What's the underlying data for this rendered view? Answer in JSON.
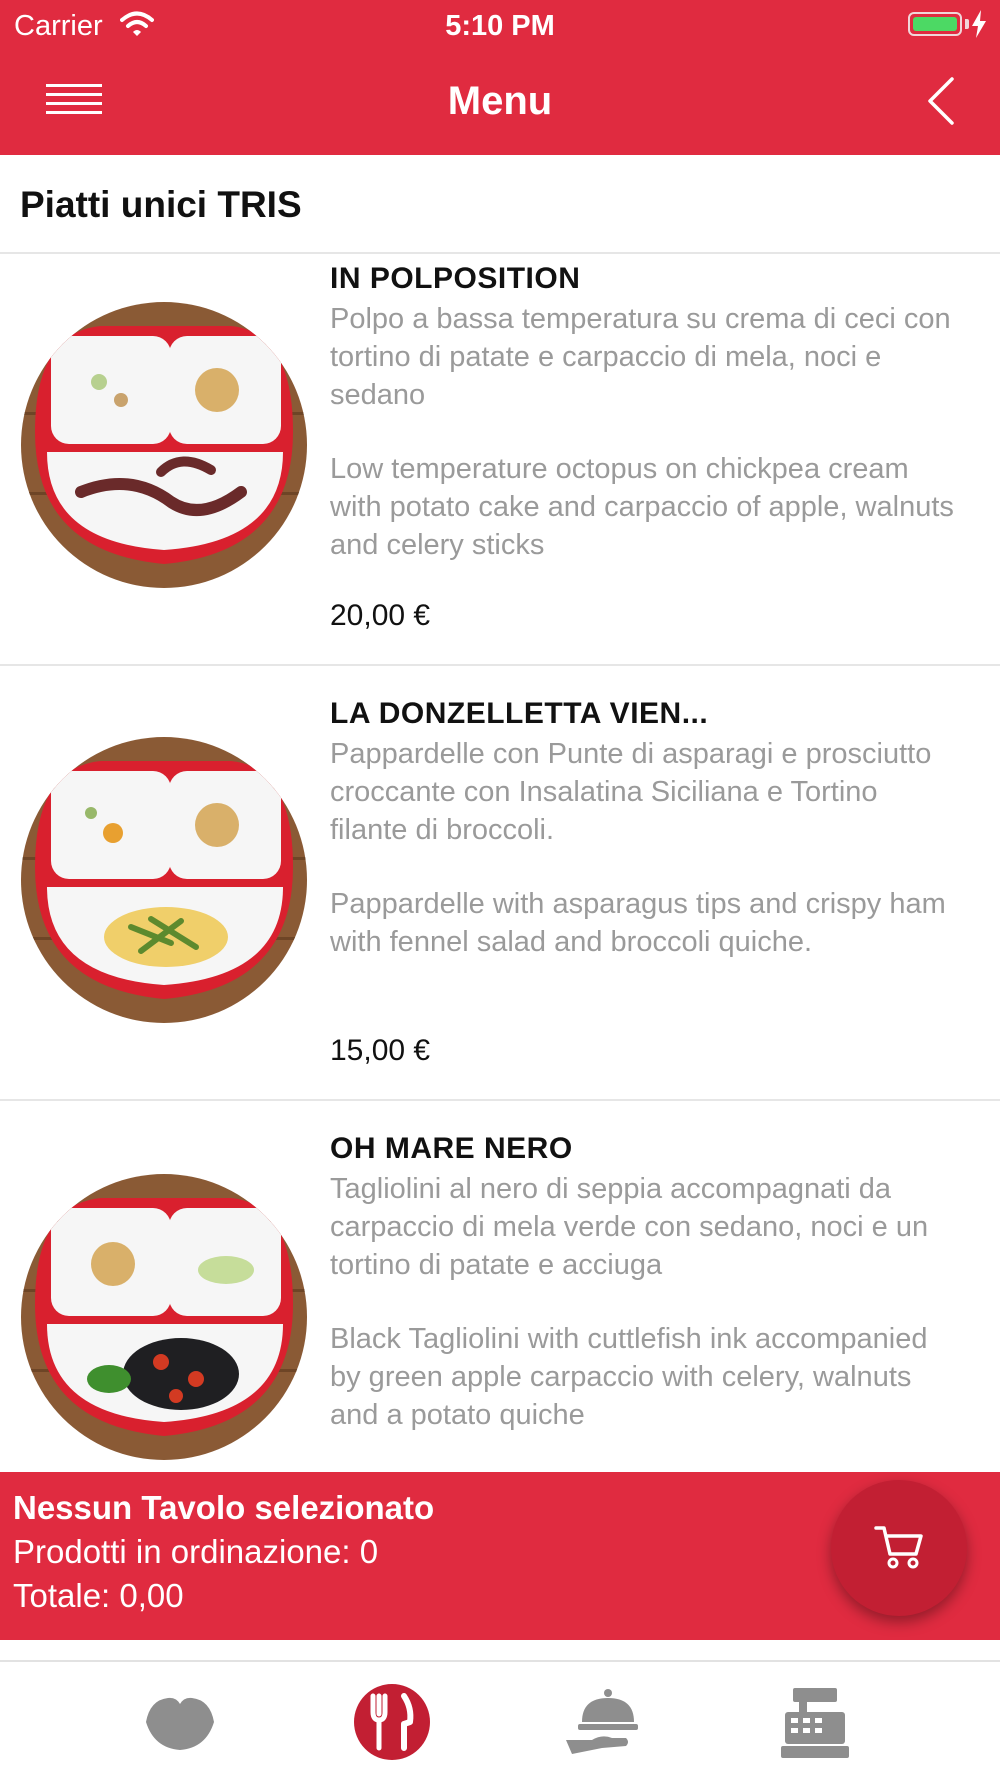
{
  "status_bar": {
    "carrier": "Carrier",
    "time": "5:10 PM"
  },
  "header": {
    "title": "Menu"
  },
  "category": {
    "title": "Piatti unici TRIS"
  },
  "items": [
    {
      "name": "IN POLPOSITION",
      "desc_it": "Polpo a bassa temperatura su crema di ceci con tortino di patate e carpaccio di mela, noci e sedano",
      "desc_en": "Low temperature octopus on chickpea cream with potato cake and carpaccio of apple, walnuts and celery sticks",
      "price": "20,00 €"
    },
    {
      "name": "LA DONZELLETTA VIEN...",
      "desc_it": "Pappardelle con Punte di asparagi e prosciutto croccante con Insalatina Siciliana e Tortino filante di broccoli.",
      "desc_en": "Pappardelle with asparagus tips and crispy ham with fennel salad and broccoli quiche.",
      "price": "15,00 €"
    },
    {
      "name": "OH MARE NERO",
      "desc_it": "Tagliolini al nero di seppia accompagnati da carpaccio di mela verde con sedano, noci e un tortino di patate e acciuga",
      "desc_en": "Black Tagliolini with cuttlefish ink accompanied by green apple carpaccio with celery, walnuts and a potato quiche"
    }
  ],
  "order_bar": {
    "table_status": "Nessun Tavolo selezionato",
    "products": "Prodotti in ordinazione: 0",
    "total": "Totale: 0,00"
  },
  "tabbar": {
    "icons": [
      "lips-icon",
      "cutlery-icon",
      "waiter-cloche-icon",
      "cash-register-icon"
    ],
    "active": "cutlery-icon"
  },
  "colors": {
    "brand_red": "#e02b40",
    "cart_red": "#c21f33",
    "desc_gray": "#9a9a9a",
    "tab_gray": "#8e8e8e"
  }
}
